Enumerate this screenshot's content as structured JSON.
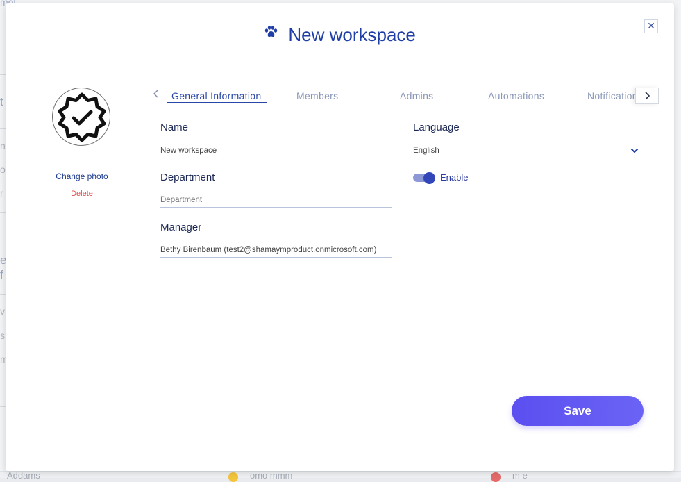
{
  "modal": {
    "title": "New workspace",
    "title_icon": "paw-icon",
    "close_label": "✕"
  },
  "photo": {
    "change_label": "Change photo",
    "delete_label": "Delete",
    "avatar_icon": "verified-badge-icon"
  },
  "tabs": [
    {
      "label": "General Information",
      "active": true
    },
    {
      "label": "Members",
      "active": false
    },
    {
      "label": "Admins",
      "active": false
    },
    {
      "label": "Automations",
      "active": false
    },
    {
      "label": "Notifications",
      "active": false
    }
  ],
  "form": {
    "name": {
      "label": "Name",
      "value": "New workspace"
    },
    "department": {
      "label": "Department",
      "placeholder": "Department"
    },
    "manager": {
      "label": "Manager",
      "value": "Bethy Birenbaum (test2@shamaymproduct.onmicrosoft.com)"
    },
    "language": {
      "label": "Language",
      "value": "English"
    },
    "enable": {
      "label": "Enable",
      "on": true
    }
  },
  "actions": {
    "save_label": "Save"
  },
  "background": {
    "fragments": [
      "mol",
      "t",
      "ni",
      "o",
      "r",
      "e",
      "f",
      "v",
      "s",
      "m"
    ],
    "bottom_texts": [
      "Addams",
      "omo mmm",
      "m e"
    ]
  },
  "colors": {
    "primary": "#1f3fa6",
    "save_gradient_start": "#5b4ff0",
    "delete_red": "#e04848",
    "toggle_knob": "#3346b8"
  }
}
